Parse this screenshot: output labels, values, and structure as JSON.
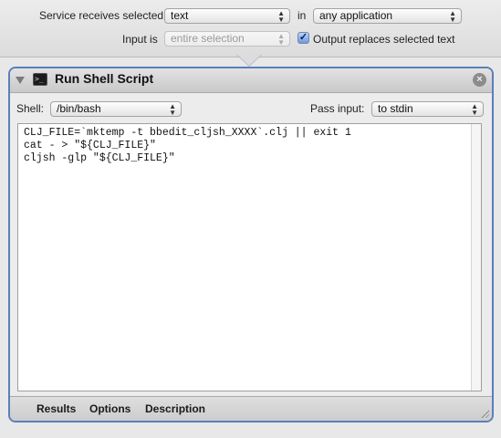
{
  "service": {
    "receives_label": "Service receives selected",
    "receives_value": "text",
    "in_label": "in",
    "application_value": "any application",
    "input_is_label": "Input is",
    "input_is_value": "entire selection",
    "output_replaces_label": "Output replaces selected text",
    "output_replaces_checked": true
  },
  "action": {
    "title": "Run Shell Script",
    "shell_label": "Shell:",
    "shell_value": "/bin/bash",
    "pass_input_label": "Pass input:",
    "pass_input_value": "to stdin",
    "script": "CLJ_FILE=`mktemp -t bbedit_cljsh_XXXX`.clj || exit 1\ncat - > \"${CLJ_FILE}\"\ncljsh -glp \"${CLJ_FILE}\"",
    "footer_tabs": [
      "Results",
      "Options",
      "Description"
    ]
  },
  "colors": {
    "panel_border": "#5b7fb8",
    "checkbox_fill": "#6d9ae0"
  },
  "icons": {
    "disclosure": "disclosure-triangle-icon",
    "action": "terminal-icon",
    "close": "close-circle-icon",
    "popup": "updown-arrows-icon",
    "resize": "resize-grip-icon"
  }
}
